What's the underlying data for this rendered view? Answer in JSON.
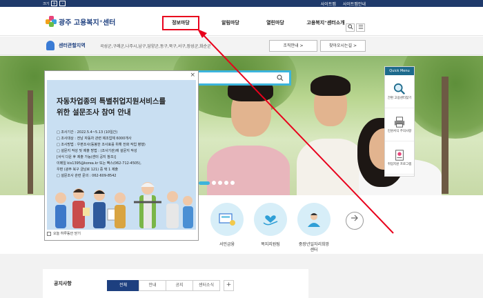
{
  "topbar": {
    "text_size_label": "크기",
    "zoom_plus": "+",
    "zoom_minus": "-",
    "links": [
      "사이트맵",
      "사이트맵안내"
    ]
  },
  "header": {
    "logo_text": "광주 고용복지⁺센터",
    "nav": [
      "정보마당",
      "알림마당",
      "열린마당",
      "고용복지⁺센터소개"
    ]
  },
  "area": {
    "title": "센터관할지역",
    "list": "곡성군,구례군,나주시,남구,담양군,동구,북구,서구,장성군,화순군",
    "btn_org": "조직안내 >",
    "btn_map": "찾아오시는길 >"
  },
  "quick_menu": {
    "title": "Quick Menu",
    "items": [
      "간편 고용센터찾기",
      "민원서식 주의사항",
      "취업지원 프로그램"
    ]
  },
  "popup": {
    "title_line1": "자동차업종의 특별취업지원서비스를",
    "title_line2": "위한 설문조사 참여 안내",
    "lines": [
      "□ 조사기간 : 2022.5.4~5.13 (10일간)",
      "□ 조사대상 : 전남 자동차 관련 제조업체 6000개사",
      "□ 조사방법 : 우편조사(동봉한 조사표를 위해 전화 작업 병행)",
      "□ 설문지 작성 및 제출 방법 : (조사기관)에 설문지 작성",
      "  [서식 다운 후 제출 가능(센터 공지 참조)]",
      "  이메일 kis1395@korea.kr 또는 팩스(062-712-4505),",
      "  우편 (광주 북구 금남로 121) 중 택 1 제출",
      "□ 설문조사 관련 문의 : 062-609-8542"
    ],
    "close_glyph": "×",
    "today_close": "오늘 하루동안 닫기"
  },
  "services": [
    {
      "label": "서민금융"
    },
    {
      "label": "복지지원팀"
    },
    {
      "label": "중장년일자리희망센터"
    }
  ],
  "notice": {
    "title": "공지사항",
    "tabs": [
      "전체",
      "안내",
      "공지",
      "센터소식"
    ],
    "more": "+"
  }
}
